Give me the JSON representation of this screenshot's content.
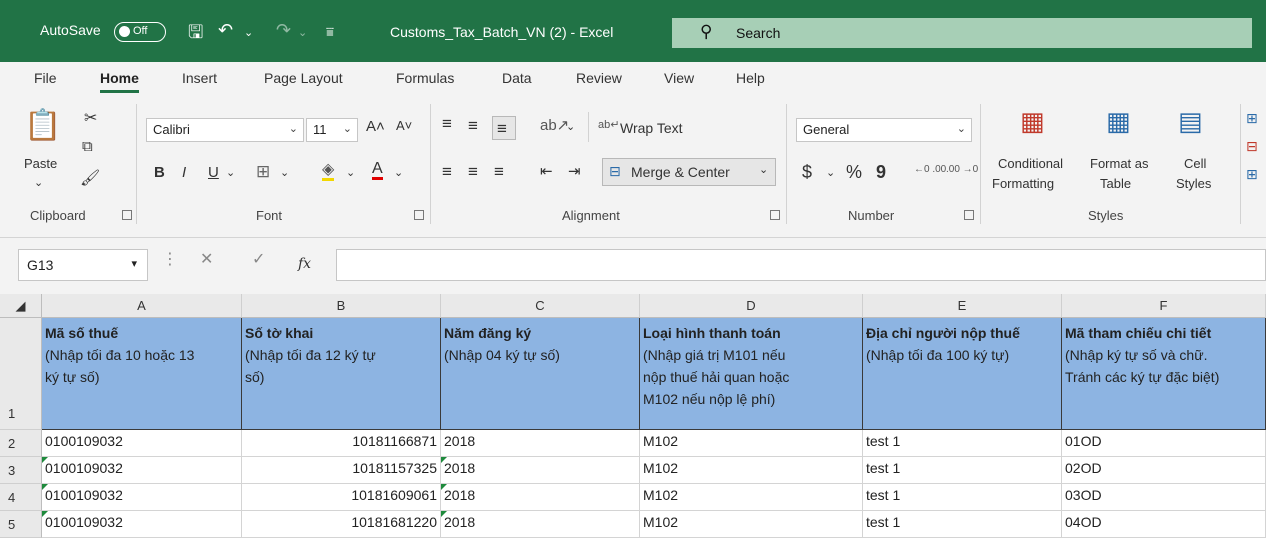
{
  "titlebar": {
    "autosave_label": "AutoSave",
    "autosave_state": "Off",
    "doc_title": "Customs_Tax_Batch_VN (2)  -  Excel",
    "search_placeholder": "Search"
  },
  "tabs": [
    "File",
    "Home",
    "Insert",
    "Page Layout",
    "Formulas",
    "Data",
    "Review",
    "View",
    "Help"
  ],
  "active_tab": "Home",
  "ribbon": {
    "clipboard": {
      "paste": "Paste",
      "label": "Clipboard"
    },
    "font": {
      "name": "Calibri",
      "size": "11",
      "bold": "B",
      "italic": "I",
      "underline": "U",
      "label": "Font"
    },
    "alignment": {
      "wrap_text": "Wrap Text",
      "merge_center": "Merge & Center",
      "label": "Alignment"
    },
    "number": {
      "format": "General",
      "currency": "$",
      "percent": "%",
      "comma": "9",
      "inc_dec": "←0 .00",
      "dec_dec": ".00 →0",
      "label": "Number"
    },
    "styles": {
      "conditional_1": "Conditional",
      "conditional_2": "Formatting",
      "format_table_1": "Format as",
      "format_table_2": "Table",
      "cell_styles_1": "Cell",
      "cell_styles_2": "Styles",
      "label": "Styles"
    }
  },
  "formula_bar": {
    "name_box": "G13",
    "fx": "fx",
    "content": ""
  },
  "columns": [
    "A",
    "B",
    "C",
    "D",
    "E",
    "F"
  ],
  "header_row": {
    "row_num": "1",
    "cells": [
      {
        "title": "Mã số thuế",
        "lines": [
          "(Nhập tối đa 10 hoặc 13",
          "ký tự số)"
        ]
      },
      {
        "title": "Số tờ khai",
        "lines": [
          "(Nhập tối đa 12 ký tự",
          "số)"
        ]
      },
      {
        "title": "Năm đăng ký",
        "lines": [
          "(Nhập 04 ký tự số)"
        ]
      },
      {
        "title": "Loại hình thanh toán",
        "lines": [
          "(Nhập giá trị M101 nếu",
          "nộp thuế hải quan hoặc",
          "M102 nếu nộp lệ phí)"
        ]
      },
      {
        "title": "Địa chỉ người nộp thuế",
        "lines": [
          "(Nhập tối đa 100 ký tự)"
        ]
      },
      {
        "title": "Mã tham chiếu chi tiết",
        "lines": [
          "(Nhập ký tự số và chữ.",
          "Tránh các ký tự đặc biệt)"
        ]
      }
    ]
  },
  "rows": [
    {
      "num": "2",
      "cells": [
        "0100109032",
        "10181166871",
        "2018",
        "M102",
        "test 1",
        "01OD"
      ]
    },
    {
      "num": "3",
      "cells": [
        "0100109032",
        "10181157325",
        "2018",
        "M102",
        "test 1",
        "02OD"
      ]
    },
    {
      "num": "4",
      "cells": [
        "0100109032",
        "10181609061",
        "2018",
        "M102",
        "test 1",
        "03OD"
      ]
    },
    {
      "num": "5",
      "cells": [
        "0100109032",
        "10181681220",
        "2018",
        "M102",
        "test 1",
        "04OD"
      ]
    }
  ],
  "colors": {
    "excel_green": "#217346",
    "header_fill": "#8db4e2",
    "text_flag": "#1e8a3c"
  }
}
